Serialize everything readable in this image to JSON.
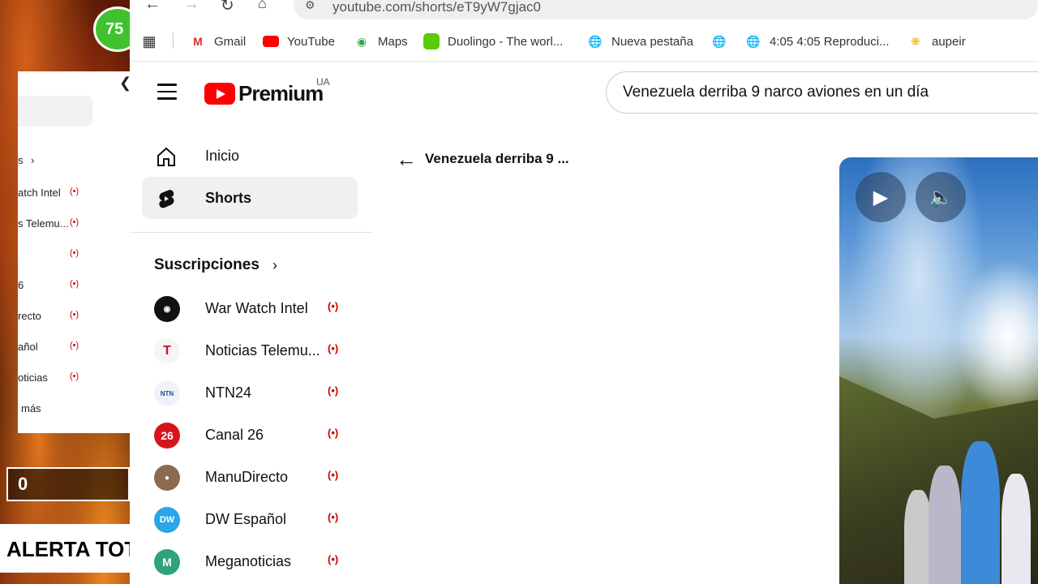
{
  "overlay": {
    "badge_text": "75",
    "score": "0",
    "alert_text": "ALERTA TOT"
  },
  "behind_panel": {
    "rows": [
      {
        "label": "s",
        "live": ""
      },
      {
        "label": "atch Intel",
        "live": "(•)"
      },
      {
        "label": "s Telemu...",
        "live": "(•)"
      },
      {
        "label": "",
        "live": "(•)"
      },
      {
        "label": "6",
        "live": "(•)"
      },
      {
        "label": "recto",
        "live": "(•)"
      },
      {
        "label": "añol",
        "live": "(•)"
      },
      {
        "label": "oticias",
        "live": "(•)"
      },
      {
        "label": "más",
        "live": ""
      }
    ]
  },
  "browser": {
    "url": "youtube.com/shorts/eT9yW7gjac0",
    "bookmarks": [
      {
        "label": "Gmail",
        "icon": "gmail-icon"
      },
      {
        "label": "YouTube",
        "icon": "youtube-icon"
      },
      {
        "label": "Maps",
        "icon": "maps-icon"
      },
      {
        "label": "Duolingo - The worl...",
        "icon": "duolingo-icon"
      },
      {
        "label": "Nueva pestaña",
        "icon": "globe-icon"
      },
      {
        "label": "",
        "icon": "globe-icon"
      },
      {
        "label": "4:05 4:05 Reproduci...",
        "icon": "globe-icon"
      },
      {
        "label": "aupeir",
        "icon": "aupeir-icon"
      }
    ]
  },
  "youtube": {
    "logo_text": "Premium",
    "region": "UA",
    "search_value": "Venezuela derriba 9 narco aviones en un día",
    "nav": [
      {
        "label": "Inicio",
        "icon": "home-icon",
        "active": false
      },
      {
        "label": "Shorts",
        "icon": "shorts-icon",
        "active": true
      }
    ],
    "subscriptions_header": "Suscripciones",
    "subscriptions": [
      {
        "name": "War Watch Intel",
        "live": "(•)"
      },
      {
        "name": "Noticias Telemu...",
        "live": "(•)"
      },
      {
        "name": "NTN24",
        "live": "(•)"
      },
      {
        "name": "Canal 26",
        "live": "(•)"
      },
      {
        "name": "ManuDirecto",
        "live": "(•)"
      },
      {
        "name": "DW Español",
        "live": "(•)"
      },
      {
        "name": "Meganoticias",
        "live": "(•)"
      }
    ],
    "short_title": "Venezuela derriba 9 ...",
    "colors": {
      "brand_red": "#ff0000",
      "live_red": "#cc0000"
    }
  }
}
